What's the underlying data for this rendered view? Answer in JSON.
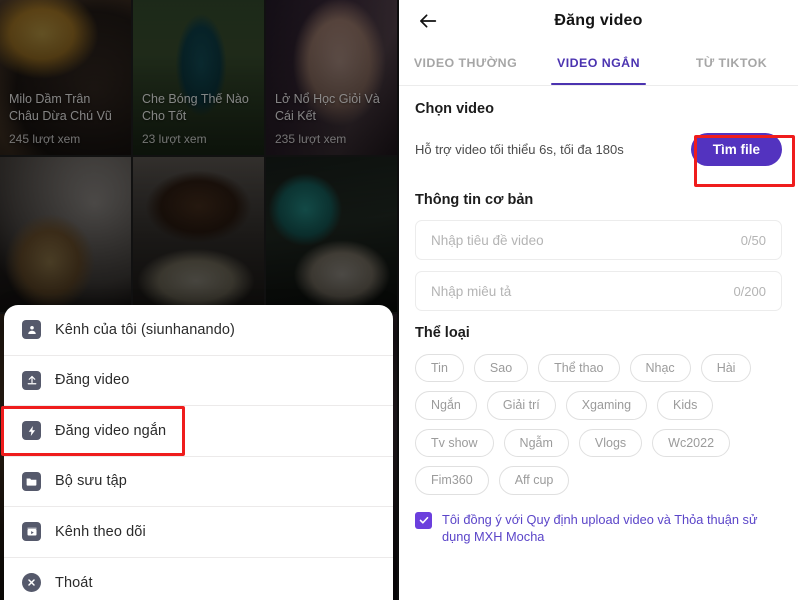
{
  "left_panel": {
    "videos": [
      {
        "title": "Milo Dầm Trân Châu Dừa Chú Vũ",
        "views": "245 lượt xem"
      },
      {
        "title": "Che Bóng Thế Nào Cho Tốt",
        "views": "23 lượt xem"
      },
      {
        "title": "Lở Nổ Học Giỏi Và Cái Kết",
        "views": "235 lượt xem"
      }
    ],
    "menu": {
      "items": [
        {
          "label": "Kênh của tôi (siunhanando)",
          "icon": "person-icon",
          "highlighted": false
        },
        {
          "label": "Đăng video",
          "icon": "upload-icon",
          "highlighted": false
        },
        {
          "label": "Đăng video ngắn",
          "icon": "lightning-icon",
          "highlighted": true
        },
        {
          "label": "Bộ sưu tập",
          "icon": "folder-icon",
          "highlighted": false
        },
        {
          "label": "Kênh theo dõi",
          "icon": "play-box-icon",
          "highlighted": false
        },
        {
          "label": "Thoát",
          "icon": "close-circle-icon",
          "highlighted": false
        }
      ]
    }
  },
  "right_panel": {
    "header": {
      "title": "Đăng video",
      "back_icon": "back-arrow-icon"
    },
    "tabs": [
      {
        "label": "VIDEO THƯỜNG",
        "active": false
      },
      {
        "label": "VIDEO NGẮN",
        "active": true
      },
      {
        "label": "TỪ TIKTOK",
        "active": false
      }
    ],
    "choose_video": {
      "section_title": "Chọn video",
      "hint": "Hỗ trợ video tối thiểu 6s, tối đa 180s",
      "button_label": "Tìm file"
    },
    "basic_info": {
      "section_title": "Thông tin cơ bản",
      "title_field": {
        "placeholder": "Nhập tiêu đề video",
        "counter": "0/50",
        "value": ""
      },
      "desc_field": {
        "placeholder": "Nhập miêu tả",
        "counter": "0/200",
        "value": ""
      }
    },
    "categories": {
      "section_title": "Thể loại",
      "chips": [
        "Tin",
        "Sao",
        "Thể thao",
        "Nhạc",
        "Hài",
        "Ngắn",
        "Giải trí",
        "Xgaming",
        "Kids",
        "Tv show",
        "Ngẫm",
        "Vlogs",
        "Wc2022",
        "Fim360",
        "Aff cup"
      ]
    },
    "agreement": {
      "checked": true,
      "text": "Tôi đồng ý với Quy định upload video và Thỏa thuận sử dụng MXH Mocha"
    }
  },
  "colors": {
    "accent_purple": "#5333bf",
    "tab_active": "#4b33b0",
    "highlight_red": "#ef1c1c",
    "link_purple": "#5b45c9",
    "icon_slate": "#55596b"
  }
}
